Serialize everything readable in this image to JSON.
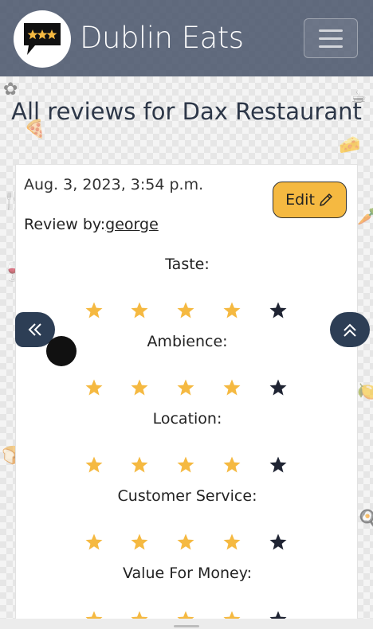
{
  "brand": {
    "name": "Dublin Eats"
  },
  "page": {
    "title": "All reviews for Dax Restaurant"
  },
  "review": {
    "date": "Aug. 3, 2023, 3:54 p.m.",
    "by_label": "Review by:",
    "author": "george",
    "edit_label": "Edit",
    "ratings": [
      {
        "label": "Taste:",
        "score": 4,
        "max": 5
      },
      {
        "label": "Ambience:",
        "score": 4,
        "max": 5
      },
      {
        "label": "Location:",
        "score": 4,
        "max": 5
      },
      {
        "label": "Customer Service:",
        "score": 4,
        "max": 5
      },
      {
        "label": "Value For Money:",
        "score": 4,
        "max": 5
      }
    ]
  },
  "icons": {
    "logo": "speech-bubble-stars-icon",
    "menu": "hamburger-icon",
    "edit": "pencil-icon",
    "back": "double-chevron-left-icon",
    "top": "double-chevron-up-icon"
  },
  "colors": {
    "navbar": "#465269",
    "accent": "#f5b941",
    "star_filled": "#f5b941",
    "star_empty": "#1f2433",
    "fab": "#2d3e55",
    "text": "#2d3748"
  }
}
